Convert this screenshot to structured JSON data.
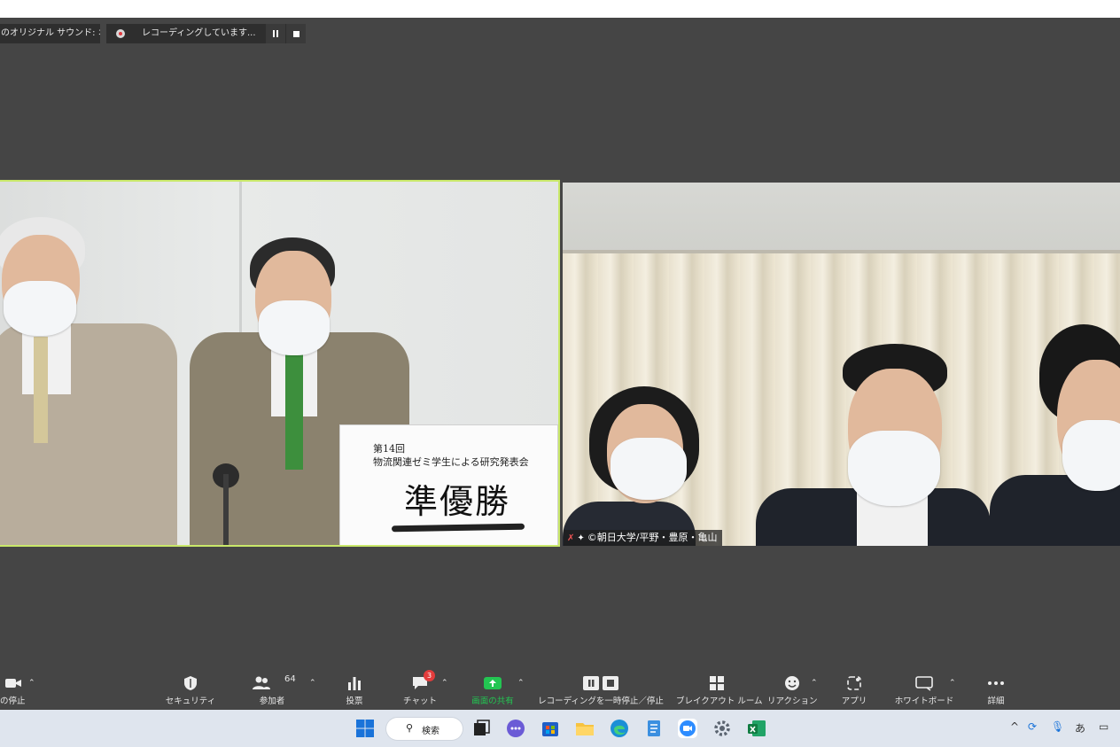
{
  "banners": {
    "sound": "のオリジナル サウンド: オフ",
    "recording": "レコーディングしています..."
  },
  "placard": {
    "line1": "第14回",
    "line2": "物流関連ゼミ学生による研究発表会",
    "big": "準優勝"
  },
  "participant_label": "©朝日大学/平野・豊原・亀山",
  "toolbar": {
    "video_stop": "の停止",
    "security": "セキュリティ",
    "participants": "参加者",
    "participants_count": "64",
    "poll": "投票",
    "chat": "チャット",
    "chat_badge": "3",
    "share": "画面の共有",
    "record_pause": "レコーディングを一時停止／停止",
    "breakout": "ブレイクアウト ルーム",
    "reactions": "リアクション",
    "apps": "アプリ",
    "whiteboard": "ホワイトボード",
    "more": "詳細"
  },
  "taskbar": {
    "search_label": "検索",
    "ime": "あ"
  },
  "colors": {
    "stage_bg": "#454545",
    "active_speaker_border": "#c9e86a",
    "share_green": "#23c552",
    "badge_red": "#e33c3c"
  }
}
